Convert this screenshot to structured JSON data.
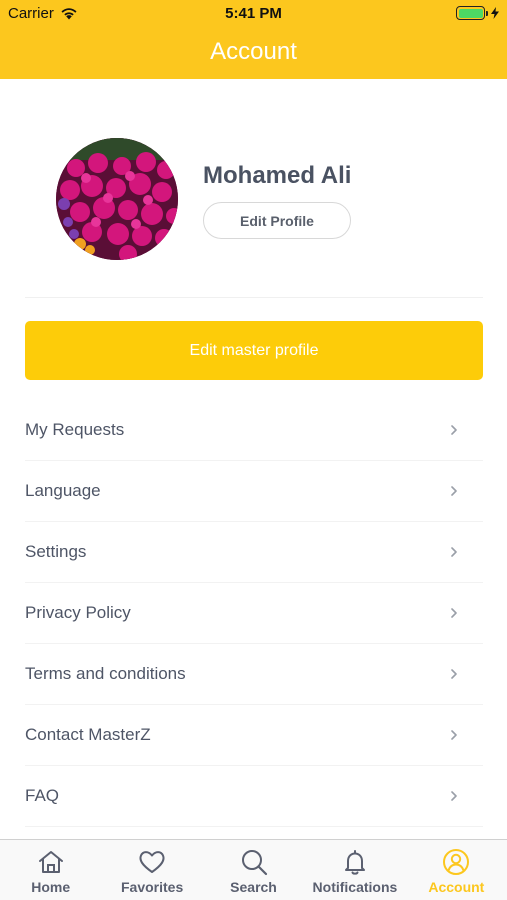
{
  "status_bar": {
    "carrier": "Carrier",
    "time": "5:41 PM"
  },
  "header": {
    "title": "Account"
  },
  "profile": {
    "name": "Mohamed Ali",
    "edit_label": "Edit Profile"
  },
  "master_button": {
    "label": "Edit master profile"
  },
  "menu": {
    "items": [
      {
        "label": "My Requests"
      },
      {
        "label": "Language"
      },
      {
        "label": "Settings"
      },
      {
        "label": "Privacy Policy"
      },
      {
        "label": "Terms and conditions"
      },
      {
        "label": "Contact MasterZ"
      },
      {
        "label": "FAQ"
      }
    ]
  },
  "tabs": [
    {
      "label": "Home",
      "icon": "home-icon"
    },
    {
      "label": "Favorites",
      "icon": "heart-icon"
    },
    {
      "label": "Search",
      "icon": "search-icon"
    },
    {
      "label": "Notifications",
      "icon": "bell-icon"
    },
    {
      "label": "Account",
      "icon": "user-icon",
      "active": true
    }
  ],
  "colors": {
    "accent": "#fcc71e",
    "button": "#fdcc09",
    "text": "#4e5566"
  }
}
